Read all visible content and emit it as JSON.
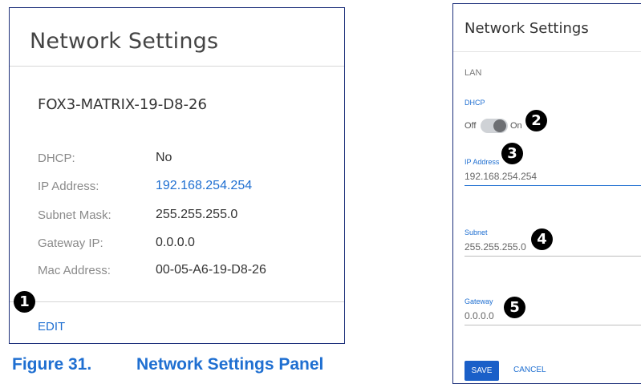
{
  "left_panel": {
    "title": "Network Settings",
    "device_name": "FOX3-MATRIX-19-D8-26",
    "rows": [
      {
        "label": "DHCP:",
        "value": "No"
      },
      {
        "label": "IP Address:",
        "value": "192.168.254.254"
      },
      {
        "label": "Subnet Mask:",
        "value": "255.255.255.0"
      },
      {
        "label": "Gateway IP:",
        "value": "0.0.0.0"
      },
      {
        "label": "Mac Address:",
        "value": "00-05-A6-19-D8-26"
      }
    ],
    "edit_label": "EDIT"
  },
  "right_panel": {
    "title": "Network Settings",
    "section": "LAN",
    "dhcp": {
      "label": "DHCP",
      "off": "Off",
      "on": "On"
    },
    "ip": {
      "label": "IP Address",
      "value": "192.168.254.254"
    },
    "subnet": {
      "label": "Subnet",
      "value": "255.255.255.0"
    },
    "gateway": {
      "label": "Gateway",
      "value": "0.0.0.0"
    },
    "save_label": "SAVE",
    "cancel_label": "CANCEL"
  },
  "callouts": [
    "1",
    "2",
    "3",
    "4",
    "5"
  ],
  "figure": {
    "number": "Figure 31.",
    "caption": "Network Settings Panel"
  },
  "colors": {
    "accent": "#1f6fd1",
    "border": "#1c2f7a",
    "save_button": "#1a5fc8"
  }
}
